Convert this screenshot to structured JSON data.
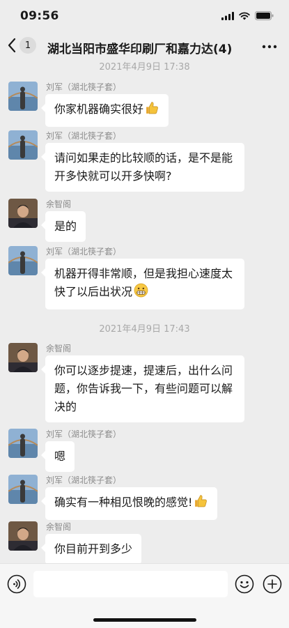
{
  "status_bar": {
    "time": "09:56"
  },
  "header": {
    "back_badge": "1",
    "title": "湖北当阳市盛华印刷厂和嘉力达(4)"
  },
  "timestamps": [
    "2021年4月9日 17:38",
    "2021年4月9日 17:43"
  ],
  "messages": [
    {
      "sender": "刘军（湖北筷子套）",
      "text": "你家机器确实很好",
      "emoji": "thumbs-up"
    },
    {
      "sender": "刘军（湖北筷子套）",
      "text": "请问如果走的比较顺的话，是不是能开多快就可以开多快啊?"
    },
    {
      "sender": "余智阁",
      "text": "是的"
    },
    {
      "sender": "刘军（湖北筷子套）",
      "text": "机器开得非常顺，但是我担心速度太快了以后出状况",
      "emoji": "grimacing-face"
    },
    {
      "sender": "余智阁",
      "text": "你可以逐步提速，提速后，出什么问题，你告诉我一下，有些问题可以解决的"
    },
    {
      "sender": "刘军（湖北筷子套）",
      "text": "嗯"
    },
    {
      "sender": "刘军（湖北筷子套）",
      "text": "确实有一种相见恨晚的感觉!",
      "emoji": "thumbs-up"
    },
    {
      "sender": "余智阁",
      "text": "你目前开到多少"
    }
  ],
  "input_bar": {
    "placeholder": ""
  },
  "colors": {
    "background": "#ededed",
    "bubble": "#ffffff",
    "timestamp": "#a8a8a8",
    "sender": "#8b8b8b"
  },
  "icons": [
    "back-chevron-icon",
    "more-icon",
    "voice-icon",
    "emoji-icon",
    "plus-icon",
    "thumbs-up-icon",
    "grimacing-face-icon"
  ]
}
